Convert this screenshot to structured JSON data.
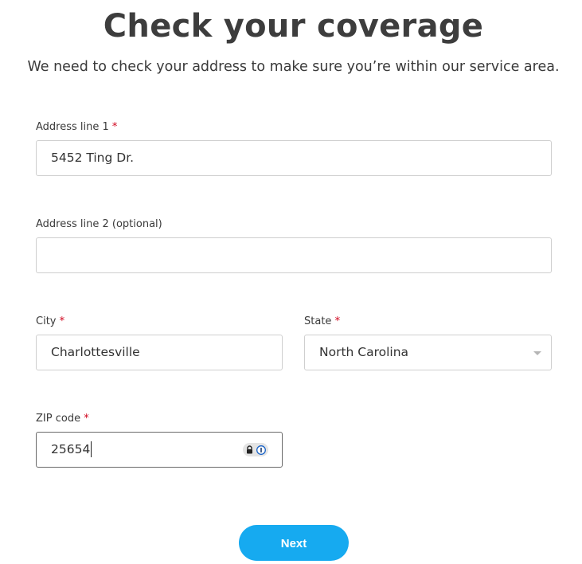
{
  "header": {
    "title": "Check your coverage",
    "subtitle": "We need to check your address to make sure you’re within our service area."
  },
  "form": {
    "address1": {
      "label": "Address line 1",
      "required_mark": "*",
      "value": "5452 Ting Dr."
    },
    "address2": {
      "label": "Address line 2 (optional)",
      "value": ""
    },
    "city": {
      "label": "City",
      "required_mark": "*",
      "value": "Charlottesville"
    },
    "state": {
      "label": "State",
      "required_mark": "*",
      "selected": "North Carolina"
    },
    "zip": {
      "label": "ZIP code",
      "required_mark": "*",
      "value": "25654",
      "password_manager_icons": [
        "lock-icon",
        "info-icon"
      ]
    }
  },
  "actions": {
    "next_label": "Next",
    "next_color": "#16aaf0"
  },
  "colors": {
    "required": "#d0021b",
    "title": "#3d3d3d"
  }
}
